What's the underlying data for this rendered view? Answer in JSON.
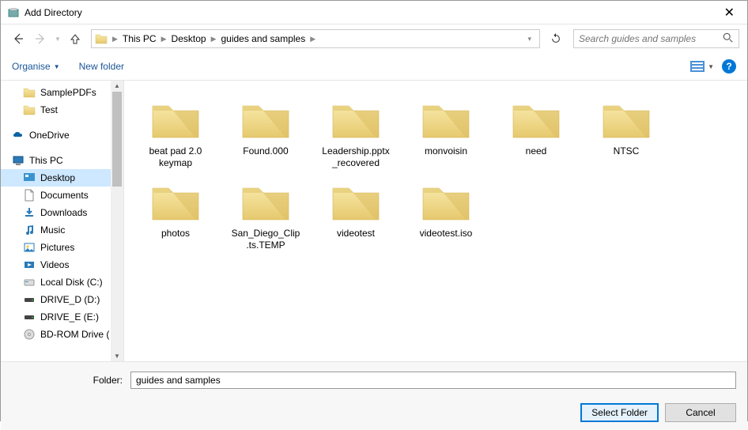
{
  "title": "Add Directory",
  "breadcrumbs": [
    "This PC",
    "Desktop",
    "guides and samples"
  ],
  "search_placeholder": "Search guides and samples",
  "toolbar": {
    "organise": "Organise",
    "newfolder": "New folder"
  },
  "sidebar": {
    "items": [
      {
        "label": "SamplePDFs",
        "type": "folder",
        "level": 2
      },
      {
        "label": "Test",
        "type": "folder",
        "level": 2
      },
      {
        "label": "OneDrive",
        "type": "onedrive",
        "level": 1,
        "spacer": true
      },
      {
        "label": "This PC",
        "type": "thispc",
        "level": 1,
        "spacer": true
      },
      {
        "label": "Desktop",
        "type": "desktop",
        "level": 2,
        "selected": true
      },
      {
        "label": "Documents",
        "type": "documents",
        "level": 2
      },
      {
        "label": "Downloads",
        "type": "downloads",
        "level": 2
      },
      {
        "label": "Music",
        "type": "music",
        "level": 2
      },
      {
        "label": "Pictures",
        "type": "pictures",
        "level": 2
      },
      {
        "label": "Videos",
        "type": "videos",
        "level": 2
      },
      {
        "label": "Local Disk (C:)",
        "type": "disk",
        "level": 2
      },
      {
        "label": "DRIVE_D (D:)",
        "type": "drive",
        "level": 2
      },
      {
        "label": "DRIVE_E (E:)",
        "type": "drive",
        "level": 2
      },
      {
        "label": "BD-ROM Drive (",
        "type": "bdrom",
        "level": 2
      }
    ]
  },
  "content": {
    "folders": [
      "beat pad 2.0 keymap",
      "Found.000",
      "Leadership.pptx_recovered",
      "monvoisin",
      "need",
      "NTSC",
      "photos",
      "San_Diego_Clip.ts.TEMP",
      "videotest",
      "videotest.iso"
    ]
  },
  "footer": {
    "label": "Folder:",
    "value": "guides and samples",
    "select": "Select Folder",
    "cancel": "Cancel"
  }
}
